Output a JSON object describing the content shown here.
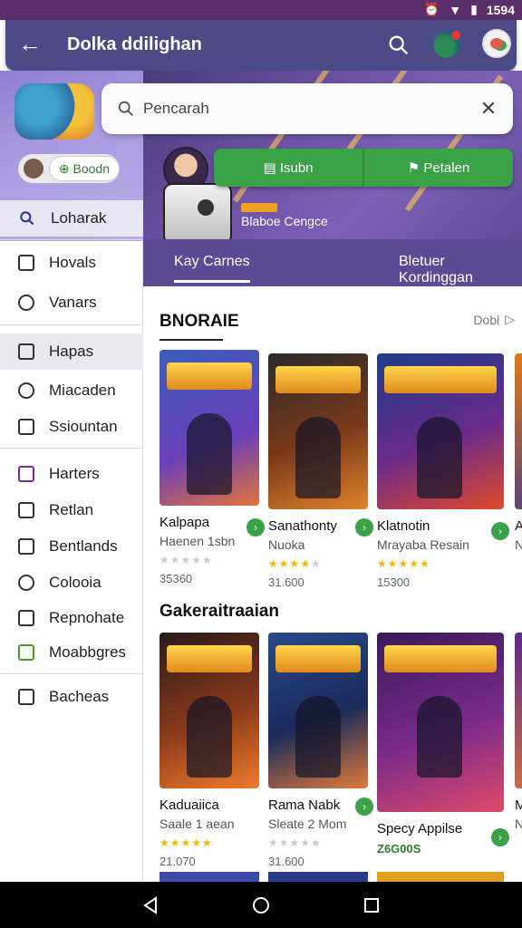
{
  "status_bar": {
    "time": "1594"
  },
  "app_bar": {
    "title": "Dolka ddilighan",
    "back_icon": "arrow-left-icon"
  },
  "search": {
    "placeholder": "Pencarah"
  },
  "drawer": {
    "profile_button": "Boodn",
    "items": [
      {
        "label": "Loharak",
        "icon": "search-icon"
      },
      {
        "label": "Hovals",
        "icon": "square-icon"
      },
      {
        "label": "Vanars",
        "icon": "info-icon"
      },
      {
        "label": "Hapas",
        "icon": "pin-icon"
      },
      {
        "label": "Miacaden",
        "icon": "person-icon"
      },
      {
        "label": "Ssiountan",
        "icon": "circle-dot-icon"
      },
      {
        "label": "Harters",
        "icon": "checkbox-icon"
      },
      {
        "label": "Retlan",
        "icon": "info-square-icon"
      },
      {
        "label": "Bentlands",
        "icon": "square-outline-icon"
      },
      {
        "label": "Colooia",
        "icon": "smiley-icon"
      },
      {
        "label": "Repnohate",
        "icon": "info-square-icon"
      },
      {
        "label": "Moabbgres",
        "icon": "check-green-icon"
      },
      {
        "label": "Bacheas",
        "icon": "folder-icon"
      }
    ]
  },
  "banner": {
    "button_left": "Isubn",
    "button_right": "Petalen",
    "subtitle": "Blaboe Cengce",
    "tabs": [
      "Kay Carnes",
      "Bletuer Kordinggan"
    ]
  },
  "sections": [
    {
      "title": "BNORAIE",
      "see_all": "Dobl",
      "cards": [
        {
          "name": "Kalpapa",
          "dev": "Haenen 1sbn",
          "rating": 0,
          "count": "35360"
        },
        {
          "name": "Sanathonty",
          "dev": "Nuoka",
          "rating": 4,
          "count": "31.600"
        },
        {
          "name": "Klatnotin",
          "dev": "Mrayaba Resain",
          "rating": 5,
          "count": "15300"
        },
        {
          "name": "A",
          "dev": "N",
          "rating": 0,
          "count": ""
        }
      ]
    },
    {
      "title": "Gakeraitraaian",
      "cards": [
        {
          "name": "Kaduaiica",
          "dev": "Saale 1 aean",
          "rating": 5,
          "count": "21.070"
        },
        {
          "name": "Rama Nabk",
          "dev": "Sleate 2 Mom",
          "rating": 0,
          "count": "31.600"
        },
        {
          "name": "Specy Appilse",
          "dev": "",
          "rating": 0,
          "count": "Z6G00S"
        },
        {
          "name": "M",
          "dev": "N",
          "rating": 0,
          "count": ""
        }
      ]
    }
  ],
  "colors": {
    "app_bar": "#4b4a86",
    "accent_green": "#3aa347",
    "banner": "#6b52a3"
  },
  "nav_bar": {
    "icons": [
      "back-triangle-icon",
      "home-circle-icon",
      "recents-square-icon"
    ]
  }
}
